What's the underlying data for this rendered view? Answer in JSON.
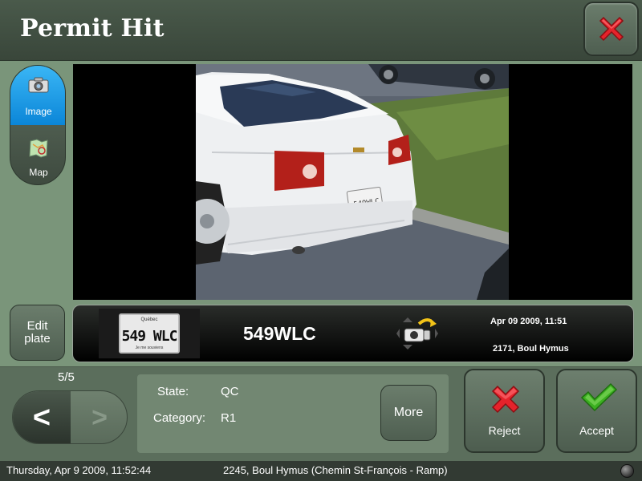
{
  "header": {
    "title": "Permit Hit",
    "close_icon": "close-x-icon"
  },
  "tabs": [
    {
      "label": "Image",
      "icon": "camera-icon",
      "selected": true
    },
    {
      "label": "Map",
      "icon": "map-icon",
      "selected": false
    }
  ],
  "edit_plate": {
    "label_line1": "Edit",
    "label_line2": "plate"
  },
  "hit": {
    "plate": "549WLC",
    "plate_crop_text": "549 WLC",
    "plate_crop_province": "Québec",
    "plate_crop_motto": "Je me souviens",
    "date": "Apr 09 2009, 11:51",
    "location": "2171, Boul Hymus",
    "camera_icon": "camera-rotate-icon"
  },
  "navigation": {
    "counter": "5/5",
    "prev_label": "<",
    "next_label": ">"
  },
  "details": {
    "state_label": "State:",
    "state_value": "QC",
    "category_label": "Category:",
    "category_value": "R1",
    "more_label": "More"
  },
  "actions": {
    "reject_label": "Reject",
    "accept_label": "Accept"
  },
  "status": {
    "datetime": "Thursday, Apr 9 2009, 11:52:44",
    "location": "2245, Boul Hymus  (Chemin St-François - Ramp)",
    "indicator": "status-led"
  },
  "colors": {
    "accent_blue": "#0b86d8",
    "reject_red": "#e02020",
    "accept_green": "#3cb021",
    "panel_green": "#7a957a"
  }
}
